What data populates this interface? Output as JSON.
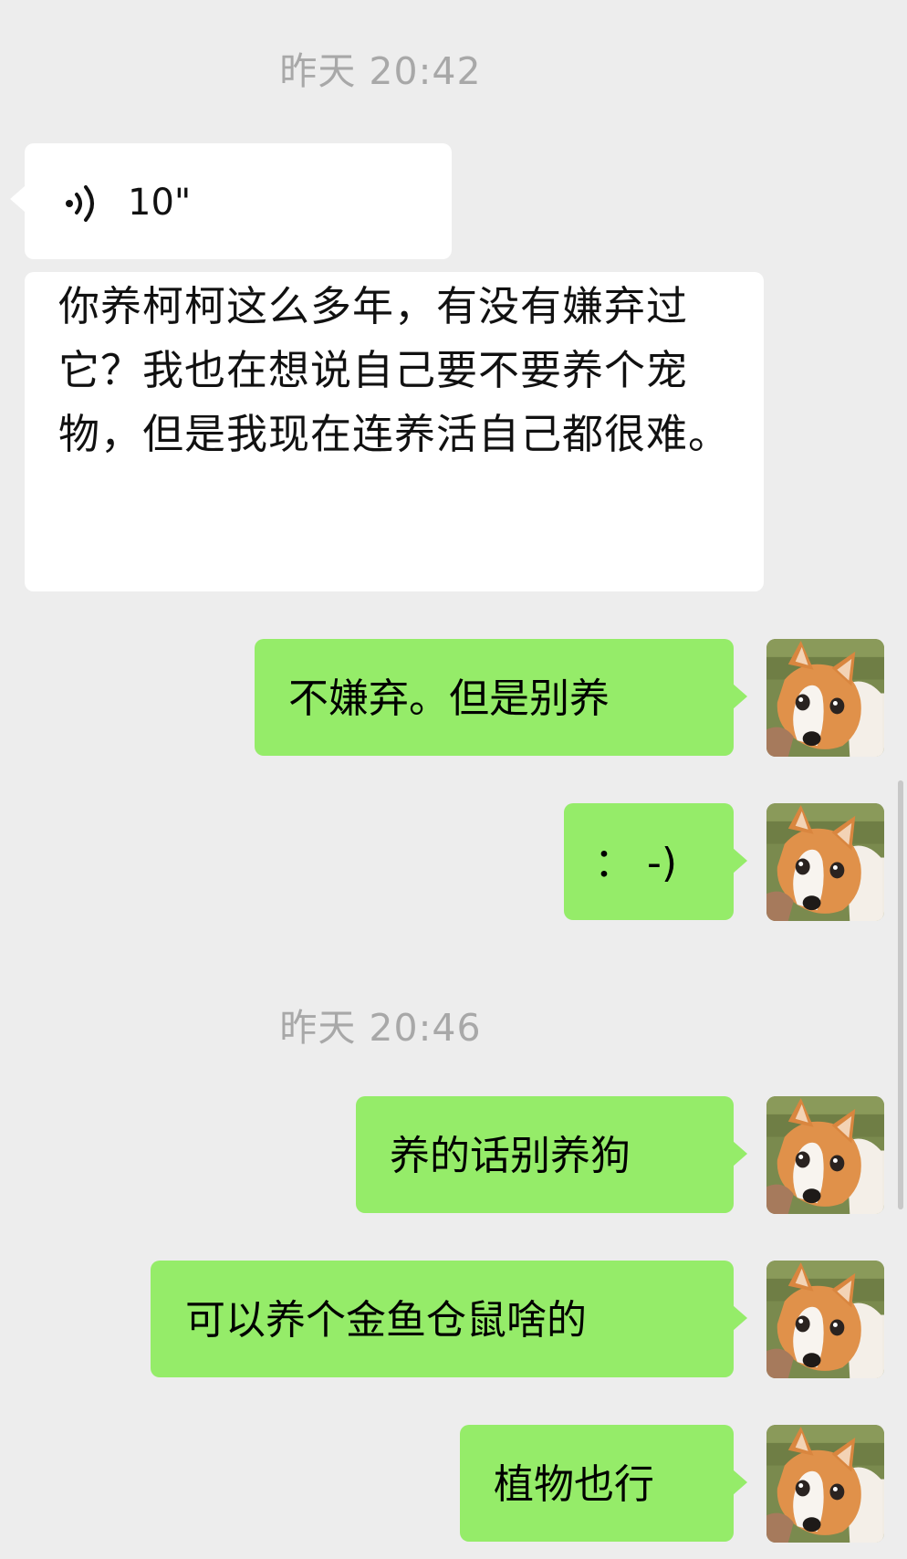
{
  "timestamps": [
    "昨天 20:42",
    "昨天 20:46"
  ],
  "incoming": {
    "voice_duration": "10\"",
    "text": "你养柯柯这么多年，有没有嫌弃过它？我也在想说自己要不要养个宠物，但是我现在连养活自己都很难。"
  },
  "outgoing": [
    {
      "text": "不嫌弃。但是别养"
    },
    {
      "text": "：  -)"
    },
    {
      "text": "养的话别养狗"
    },
    {
      "text": "可以养个金鱼仓鼠啥的"
    },
    {
      "text": "植物也行"
    }
  ],
  "colors": {
    "background": "#ededed",
    "incoming_bubble": "#ffffff",
    "outgoing_bubble": "#95ec69",
    "timestamp": "#a8a8a8"
  },
  "icons": {
    "voice": "voice-wave-icon",
    "avatar": "corgi-avatar"
  }
}
